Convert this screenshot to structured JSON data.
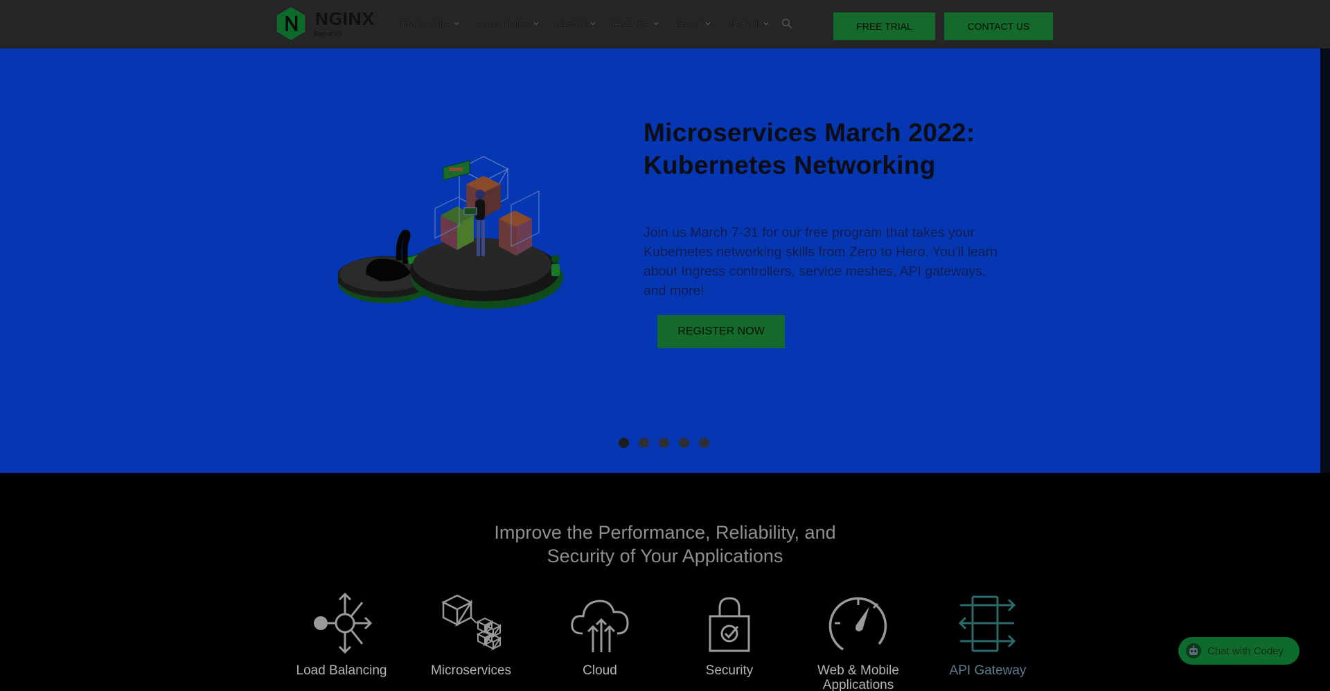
{
  "header": {
    "logo": {
      "word": "NGINX",
      "sub": "Part of F5"
    },
    "nav": [
      {
        "label": "PRODUCTS"
      },
      {
        "label": "SOLUTIONS"
      },
      {
        "label": "LEARN"
      },
      {
        "label": "EVENTS"
      },
      {
        "label": "BLOG"
      },
      {
        "label": "ABOUT"
      }
    ],
    "free_trial_label": "FREE TRIAL",
    "contact_label": "CONTACT US"
  },
  "hero": {
    "title_line1": "Microservices March 2022:",
    "title_line2": "Kubernetes Networking",
    "description": "Join us March 7-31 for our free program that takes your Kubernetes networking skills from Zero to Hero. You'll learn about Ingress controllers, service meshes, API gateways, and more!",
    "register_label": "REGISTER NOW",
    "slide_count": 5,
    "active_slide": 1
  },
  "features": {
    "title_line1": "Improve the Performance, Reliability, and",
    "title_line2": "Security of Your Applications",
    "items": [
      {
        "label": "Load Balancing",
        "icon": "load-balancing-icon"
      },
      {
        "label": "Microservices",
        "icon": "microservices-icon"
      },
      {
        "label": "Cloud",
        "icon": "cloud-icon"
      },
      {
        "label": "Security",
        "icon": "security-icon"
      },
      {
        "label": "Web & Mobile Applications",
        "icon": "speedometer-icon"
      },
      {
        "label": "API Gateway",
        "icon": "api-gateway-icon"
      }
    ]
  },
  "chat": {
    "label": "Chat with Codey"
  },
  "colors": {
    "header_bg": "#252525",
    "hero_bg": "#0437b1",
    "brand_green": "#136a2a",
    "page_bg": "#000000"
  }
}
